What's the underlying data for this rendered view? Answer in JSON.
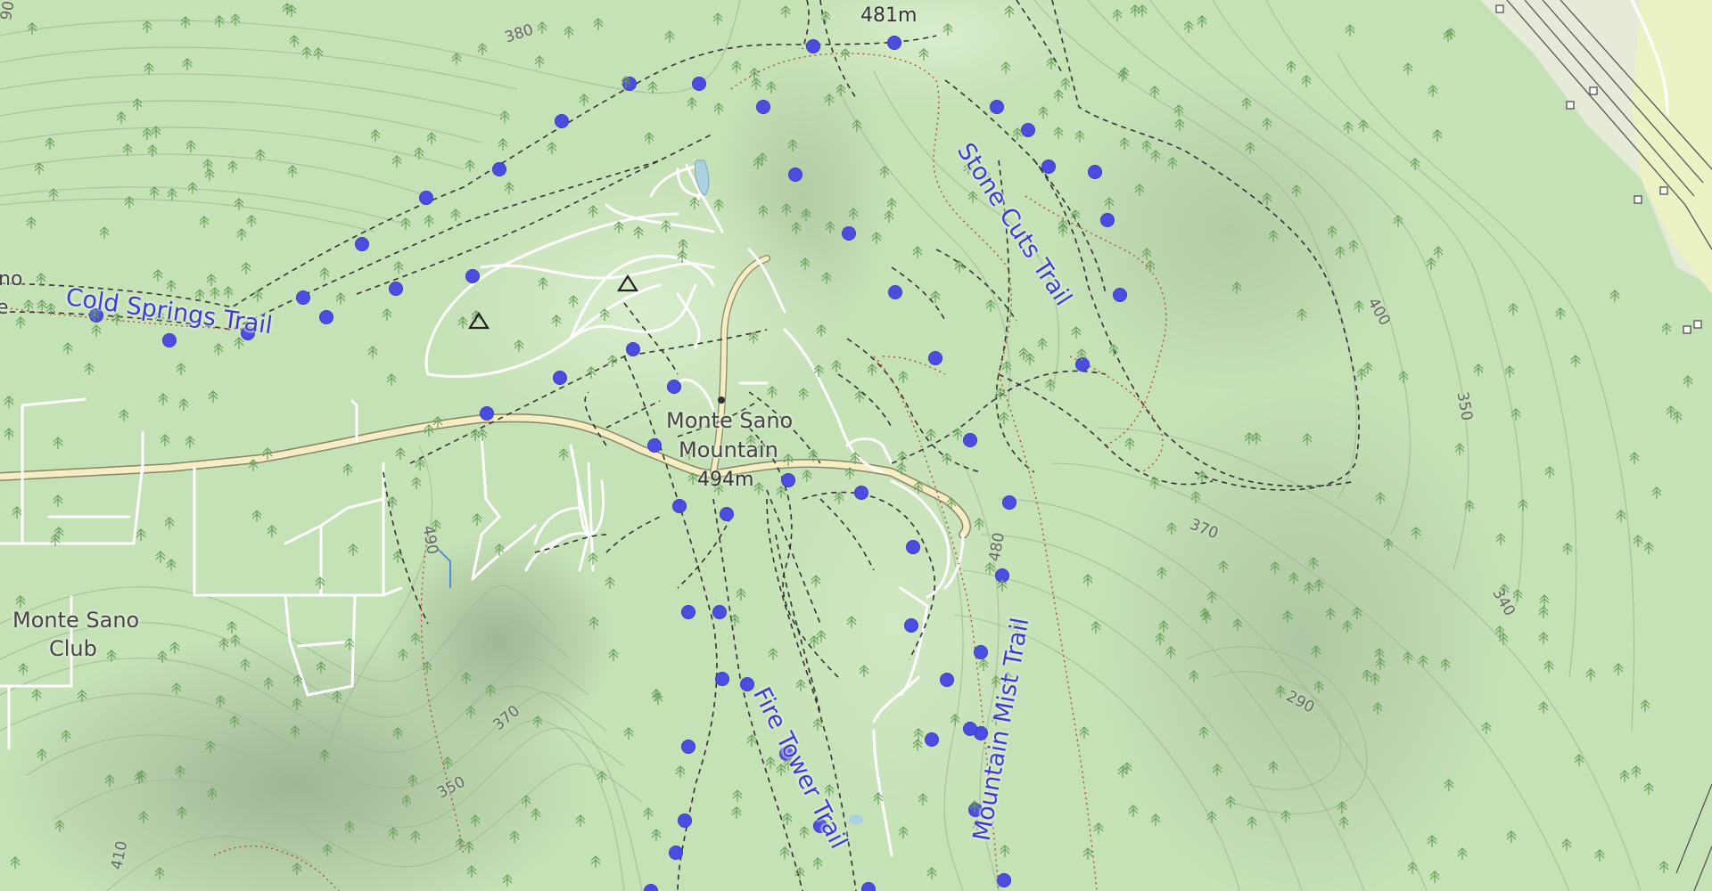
{
  "map": {
    "trails": [
      {
        "name": "Cold Springs Trail"
      },
      {
        "name": "Stone Cuts Trail"
      },
      {
        "name": "Fire Tower Trail"
      },
      {
        "name": "Mountain Mist Trail"
      }
    ],
    "places": {
      "summit_name_line1": "Monte Sano",
      "summit_name_line2": "Mountain",
      "summit_elevation": "494m",
      "north_peak_elevation": "481m",
      "club_line1": "Monte Sano",
      "club_line2": "Club",
      "edge_fragment_1": "no",
      "edge_fragment_2": "e"
    },
    "contour_labels": [
      "380",
      "400",
      "350",
      "370",
      "340",
      "290",
      "490",
      "480",
      "370",
      "350",
      "410",
      "90"
    ],
    "colors": {
      "land": "#c5e1b6",
      "trail_marker": "#4b4de0",
      "trail_label": "#3d3ad6",
      "road": "#f6eec3",
      "path": "#333333",
      "contour": "#9fb596"
    }
  }
}
